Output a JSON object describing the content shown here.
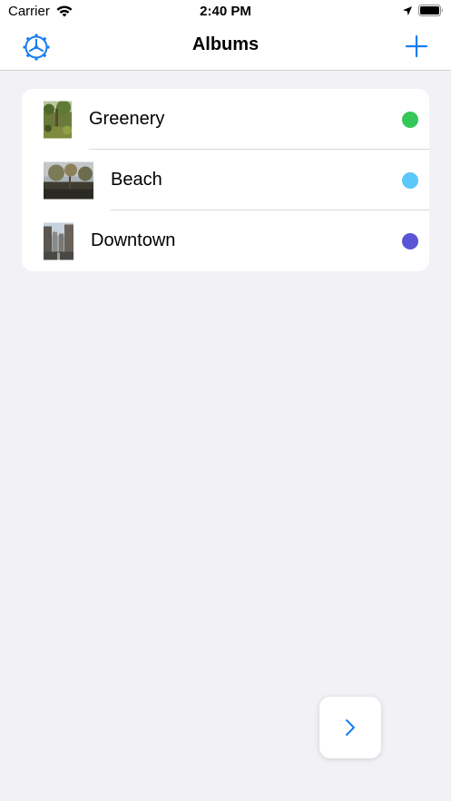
{
  "status_bar": {
    "carrier": "Carrier",
    "time": "2:40 PM",
    "icons": [
      "wifi-icon",
      "location-arrow-icon",
      "battery-icon"
    ]
  },
  "nav": {
    "title": "Albums",
    "left_icon": "settings-gear-icon",
    "right_icon": "add-icon",
    "accent": "#1a7cf0"
  },
  "albums": [
    {
      "name": "Greenery",
      "color": "#35c759",
      "thumb": "greenery-photo"
    },
    {
      "name": "Beach",
      "color": "#5ac8fa",
      "thumb": "beach-photo"
    },
    {
      "name": "Downtown",
      "color": "#5856d6",
      "thumb": "downtown-photo"
    }
  ],
  "floating_button": {
    "icon": "chevron-right-icon"
  }
}
